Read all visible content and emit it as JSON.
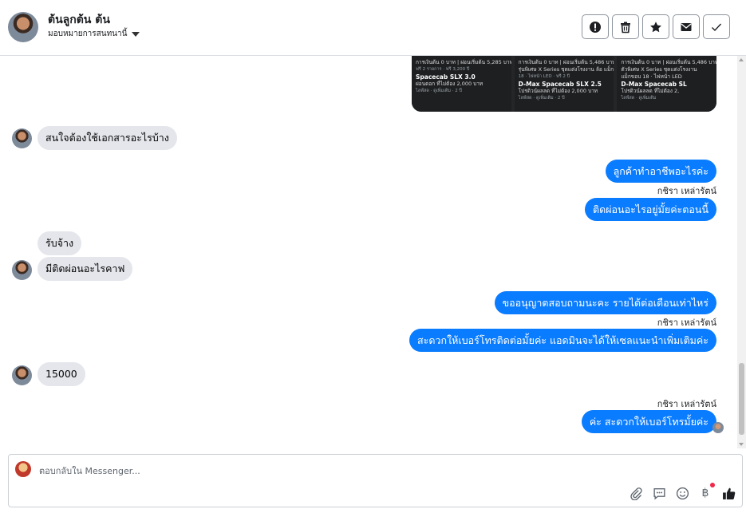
{
  "header": {
    "contact_name": "ต้นลูกต้น ต้น",
    "assign_label": "มอบหมายการสนทนานี้",
    "actions": [
      {
        "icon": "alert-icon",
        "name": "mark-spam-button"
      },
      {
        "icon": "trash-icon",
        "name": "delete-button"
      },
      {
        "icon": "star-icon",
        "name": "star-button"
      },
      {
        "icon": "envelope-icon",
        "name": "mark-unread-button"
      },
      {
        "icon": "check-icon",
        "name": "mark-done-button"
      }
    ]
  },
  "shared_cards": [
    {
      "l1": "การเงินต้น 0 บาท | ผ่อนเริ่มต้น 5,285 บาท | 84 งวด",
      "l2": "ฟรี 2 รายการ · ฟรี 3,200 ปี",
      "l3": "Spacecab SLX 3.0",
      "l4": "ผ่อนดอก ที่ไม่ต้อง 2,000 บาท",
      "l5": "ไลฟ์สด · ดูเพิ่มเติม · 2 ปี"
    },
    {
      "l1": "การเงินต้น 0 บาท | ผ่อนเริ่มต้น 5,486 บาท | 84 งวด",
      "l2": "รุ่นพิเศษ X Series ชุดแต่งโรงงาน ล้อ แม็ก แฟชั่น ขอบ",
      "l3": "18 · ไฟหน้า LED · ฟรี 2 ปี",
      "l4": "D-Max Spacecab SLX 2.5",
      "l5": "โปรดิวน์ผลลด ที่ไม่ต้อง 2,000 บาท",
      "l6": "ไลฟ์สด · ดูเพิ่มเติม · 2 ปี"
    },
    {
      "l1": "การเงินต้น 0 บาท | ผ่อนเริ่มต้น 5,486 บาท | 84 งวด",
      "l2": "ตัวพิเศษ X Series ชุดแต่งโรงงาน",
      "l3": "แม็กขอบ 18 · ไฟหน้า LED",
      "l4": "D-Max Spacecab SL",
      "l5": "โปรดิวน์ผลลด ที่ไม่ต้อง 2,",
      "l6": "ไลฟ์สด · ดูเพิ่มเติม"
    }
  ],
  "messages": {
    "m1": "สนใจต้องใช้เอกสารอะไรบ้าง",
    "m2": "ลูกค้าทำอาชีพอะไรค่ะ",
    "m3": "ติดผ่อนอะไรอยู่มั้ยค่ะตอนนี้",
    "m4": "รับจ้าง",
    "m5": "มีติดผ่อนอะไรคาฟ",
    "m6": "ขออนุญาตสอบถามนะคะ รายได้ต่อเดือนเท่าไหร่",
    "m7": "สะดวกให้เบอร์โทรติดต่อมั้ยค่ะ แอดมินจะได้ให้เซลแนะนำเพิ่มเติมค่ะ",
    "m8": "15000",
    "m9": "ค่ะ สะดวกให้เบอร์โทรมั้ยค่ะ"
  },
  "sender_name": "กชิรา เหล่ารัตน์",
  "composer": {
    "placeholder": "ตอบกลับใน Messenger...",
    "tools": [
      "paperclip-icon",
      "saved-reply-icon",
      "emoji-icon",
      "baht-icon",
      "thumbs-up-icon"
    ]
  }
}
